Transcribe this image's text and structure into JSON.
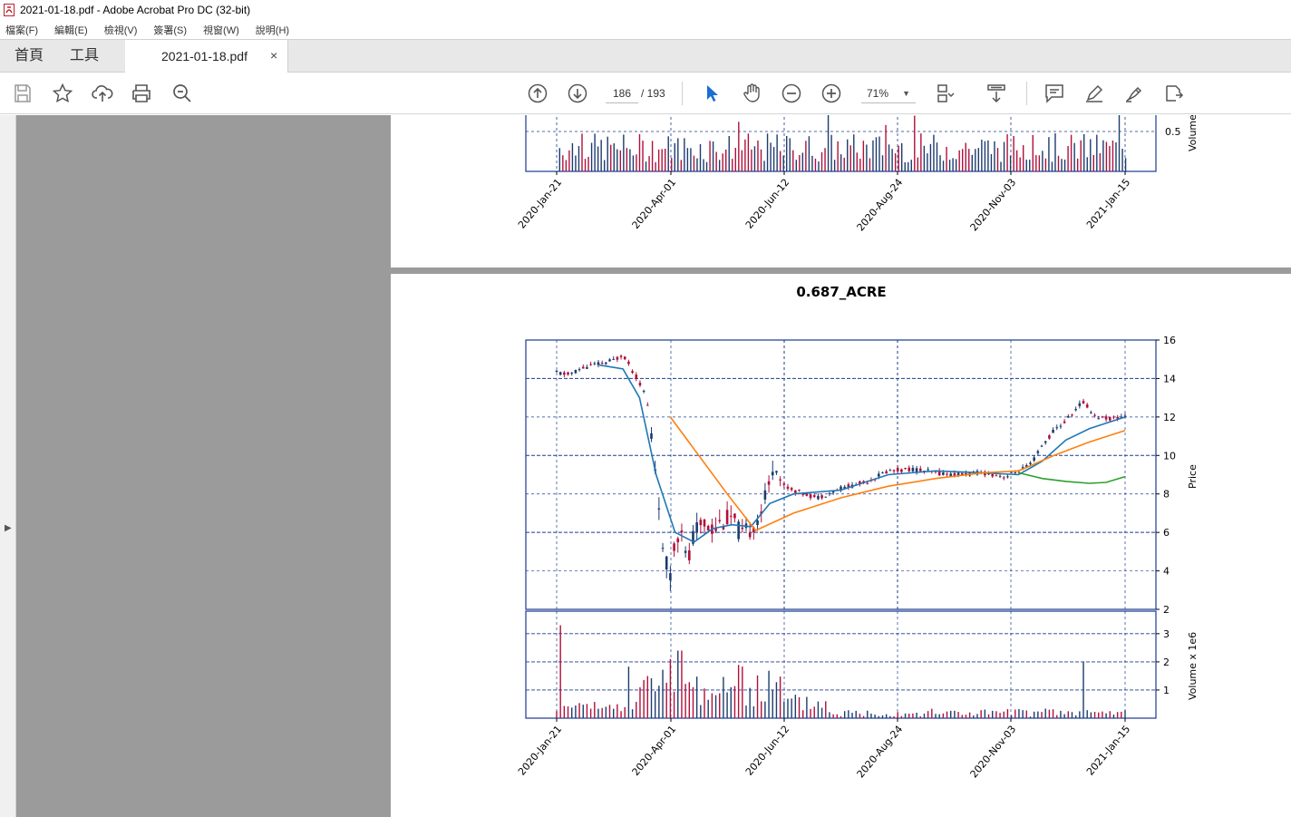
{
  "window": {
    "title": "2021-01-18.pdf - Adobe Acrobat Pro DC (32-bit)"
  },
  "menu": [
    "檔案(F)",
    "編輯(E)",
    "檢視(V)",
    "簽署(S)",
    "視窗(W)",
    "說明(H)"
  ],
  "tabs": {
    "home": "首頁",
    "tools": "工具",
    "document": "2021-01-18.pdf",
    "close_symbol": "×"
  },
  "toolbar": {
    "page_current": "186",
    "page_total": "/ 193",
    "zoom": "71%",
    "icons": [
      "save-icon",
      "star-icon",
      "upload-icon",
      "print-icon",
      "zoom-search-icon",
      "page-up-icon",
      "page-down-icon",
      "select-arrow-icon",
      "hand-icon",
      "zoom-out-icon",
      "zoom-in-icon",
      "fit-page-icon",
      "scroll-mode-icon",
      "comment-icon",
      "highlight-icon",
      "sign-icon",
      "export-icon"
    ],
    "accent": "#1a6fd0"
  },
  "chart_data": {
    "type": "candlestick",
    "title": "0.687_ACRE",
    "price_ylabel": "Price",
    "volume_ylabel": "Volume x 1e6",
    "top_volume_ylabel": "Volume",
    "price_yticks": [
      2,
      4,
      6,
      8,
      10,
      12,
      14,
      16
    ],
    "price_ylim": [
      2,
      16
    ],
    "volume_yticks": [
      1,
      2,
      3
    ],
    "top_volume_yticks": [
      "0.5"
    ],
    "x_tick_labels": [
      "2020-Jan-21",
      "2020-Apr-01",
      "2020-Jun-12",
      "2020-Aug-24",
      "2020-Nov-03",
      "2021-Jan-15"
    ],
    "colors": {
      "up": "#1c3b6e",
      "down": "#b0103a",
      "ma_short": "#1f77b4",
      "ma_mid": "#ff7f0e",
      "ma_long": "#2ca02c",
      "grid": "#1c3b8f"
    },
    "price_series_approx": [
      [
        0,
        14.3
      ],
      [
        5,
        14.2
      ],
      [
        10,
        14.5
      ],
      [
        15,
        14.7
      ],
      [
        20,
        14.8
      ],
      [
        25,
        15.0
      ],
      [
        28,
        15.3
      ],
      [
        32,
        14.4
      ],
      [
        35,
        13.8
      ],
      [
        38,
        13.0
      ],
      [
        40,
        11.0
      ],
      [
        43,
        8.0
      ],
      [
        45,
        4.5
      ],
      [
        48,
        4.0
      ],
      [
        50,
        5.5
      ],
      [
        53,
        6.5
      ],
      [
        55,
        4.0
      ],
      [
        58,
        6.0
      ],
      [
        62,
        6.5
      ],
      [
        66,
        6.2
      ],
      [
        70,
        6.6
      ],
      [
        74,
        6.8
      ],
      [
        78,
        5.8
      ],
      [
        82,
        6.2
      ],
      [
        86,
        7.0
      ],
      [
        90,
        8.5
      ],
      [
        92,
        10.0
      ],
      [
        95,
        8.5
      ],
      [
        100,
        8.2
      ],
      [
        110,
        7.8
      ],
      [
        120,
        8.3
      ],
      [
        130,
        8.6
      ],
      [
        140,
        9.2
      ],
      [
        150,
        9.3
      ],
      [
        160,
        9.1
      ],
      [
        170,
        9.0
      ],
      [
        180,
        9.1
      ],
      [
        190,
        8.9
      ],
      [
        200,
        9.5
      ],
      [
        205,
        10.5
      ],
      [
        210,
        11.3
      ],
      [
        215,
        11.8
      ],
      [
        222,
        12.8
      ],
      [
        228,
        12.0
      ],
      [
        235,
        11.9
      ],
      [
        240,
        12.1
      ]
    ],
    "ma_short_approx": [
      [
        18,
        14.7
      ],
      [
        28,
        14.5
      ],
      [
        35,
        13.0
      ],
      [
        42,
        9.0
      ],
      [
        50,
        6.0
      ],
      [
        58,
        5.5
      ],
      [
        66,
        6.2
      ],
      [
        74,
        6.4
      ],
      [
        82,
        6.3
      ],
      [
        90,
        7.5
      ],
      [
        100,
        8.0
      ],
      [
        120,
        8.2
      ],
      [
        140,
        9.0
      ],
      [
        160,
        9.2
      ],
      [
        180,
        9.1
      ],
      [
        195,
        9.0
      ],
      [
        205,
        9.7
      ],
      [
        215,
        10.8
      ],
      [
        225,
        11.4
      ],
      [
        240,
        12.0
      ]
    ],
    "ma_mid_approx": [
      [
        48,
        12.0
      ],
      [
        60,
        10.0
      ],
      [
        72,
        8.0
      ],
      [
        84,
        6.1
      ],
      [
        100,
        7.0
      ],
      [
        120,
        7.8
      ],
      [
        140,
        8.4
      ],
      [
        160,
        8.8
      ],
      [
        180,
        9.1
      ],
      [
        195,
        9.2
      ],
      [
        210,
        10.0
      ],
      [
        225,
        10.7
      ],
      [
        240,
        11.3
      ]
    ],
    "ma_long_approx": [
      [
        195,
        9.1
      ],
      [
        205,
        8.8
      ],
      [
        215,
        8.65
      ],
      [
        225,
        8.55
      ],
      [
        232,
        8.6
      ],
      [
        240,
        8.9
      ]
    ]
  }
}
